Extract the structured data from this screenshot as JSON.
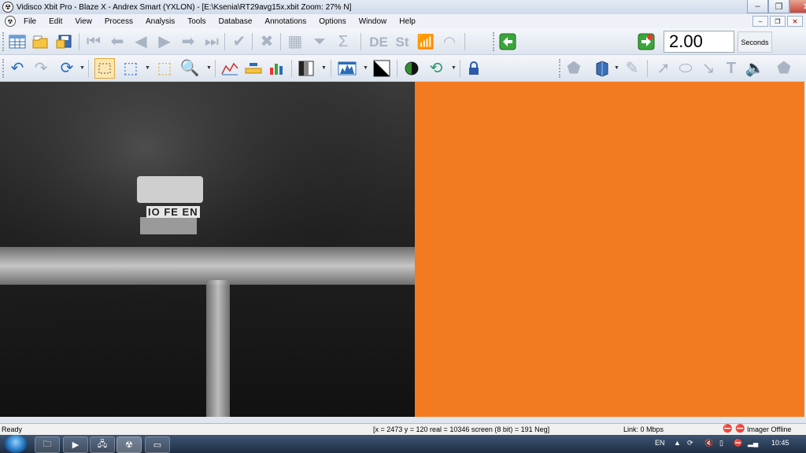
{
  "window": {
    "title": "Vidisco Xbit Pro - Blaze X - Andrex Smart (YXLON) - [E:\\Ksenia\\RT29avg15x.xbit  Zoom: 27% N]",
    "minimize_label": "–",
    "maximize_label": "❐",
    "close_label": "✕"
  },
  "menu": {
    "items": [
      "File",
      "Edit",
      "View",
      "Process",
      "Analysis",
      "Tools",
      "Database",
      "Annotations",
      "Options",
      "Window",
      "Help"
    ]
  },
  "toolbar1": {
    "labels": {
      "de": "DE",
      "st": "St"
    },
    "exposure": {
      "value": "2.00",
      "unit": "Seconds",
      "slider_position": 0.02
    }
  },
  "image": {
    "marker_text": "IO FE EN",
    "colors": {
      "background": "#1e1e1e",
      "right_panel": "#f37a21"
    }
  },
  "status": {
    "ready": "Ready",
    "coordinates": "[x = 2473 y = 120 real = 10346 screen (8 bit) = 191 Neg]",
    "link": "Link: 0 Mbps",
    "imager": "Imager Offline"
  },
  "taskbar": {
    "language": "EN",
    "clock": "10:45"
  }
}
